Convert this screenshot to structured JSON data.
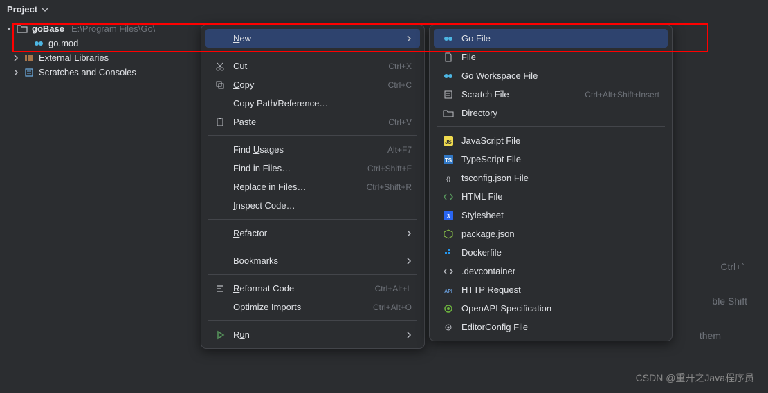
{
  "panel": {
    "title": "Project"
  },
  "tree": {
    "root": "goBase",
    "rootPath": "E:\\Program Files\\Go\\",
    "file1": "go.mod",
    "ext": "External Libraries",
    "scratch": "Scratches and Consoles"
  },
  "menu1": {
    "new": "New",
    "cut": "Cut",
    "cutKey": "Ctrl+X",
    "copy": "Copy",
    "copyKey": "Ctrl+C",
    "copyPath": "Copy Path/Reference…",
    "paste": "Paste",
    "pasteKey": "Ctrl+V",
    "findUsages": "Find Usages",
    "findUsagesKey": "Alt+F7",
    "findInFiles": "Find in Files…",
    "findInFilesKey": "Ctrl+Shift+F",
    "replaceInFiles": "Replace in Files…",
    "replaceInFilesKey": "Ctrl+Shift+R",
    "inspect": "Inspect Code…",
    "refactor": "Refactor",
    "bookmarks": "Bookmarks",
    "reformat": "Reformat Code",
    "reformatKey": "Ctrl+Alt+L",
    "optimize": "Optimize Imports",
    "optimizeKey": "Ctrl+Alt+O",
    "run": "Run"
  },
  "menu2": {
    "goFile": "Go File",
    "file": "File",
    "goWs": "Go Workspace File",
    "scratchFile": "Scratch File",
    "scratchKey": "Ctrl+Alt+Shift+Insert",
    "directory": "Directory",
    "jsFile": "JavaScript File",
    "tsFile": "TypeScript File",
    "tsconfig": "tsconfig.json File",
    "htmlFile": "HTML File",
    "stylesheet": "Stylesheet",
    "packageJson": "package.json",
    "dockerfile": "Dockerfile",
    "devcontainer": ".devcontainer",
    "httpReq": "HTTP Request",
    "openapi": "OpenAPI Specification",
    "editorconfig": "EditorConfig File"
  },
  "bg": {
    "t1": "Ctrl+`",
    "t2": "ble Shift",
    "t3": "them"
  },
  "watermark": "CSDN @重开之Java程序员"
}
